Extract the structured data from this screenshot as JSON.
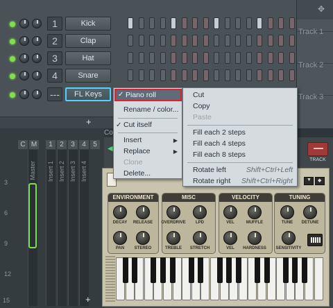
{
  "channels": [
    {
      "num": "1",
      "name": "Kick"
    },
    {
      "num": "2",
      "name": "Clap"
    },
    {
      "num": "3",
      "name": "Hat"
    },
    {
      "num": "4",
      "name": "Snare"
    },
    {
      "num": "---",
      "name": "FL Keys"
    }
  ],
  "kick_steps_on": [
    1,
    0,
    0,
    0,
    1,
    0,
    0,
    0,
    1,
    0,
    0,
    0,
    1,
    0,
    0,
    0
  ],
  "rack": {
    "add_label": "+"
  },
  "song": {
    "tracks": [
      "Track 1",
      "Track 2",
      "Track 3"
    ]
  },
  "mixer": {
    "tabs": [
      "C",
      "M",
      "1",
      "2",
      "3",
      "4",
      "5"
    ],
    "strips": [
      "Master",
      "Insert 1",
      "Insert 2",
      "Insert 3",
      "Insert 4"
    ],
    "levels": [
      "3",
      "6",
      "9",
      "12",
      "15"
    ],
    "add_label": "+"
  },
  "plugin": {
    "bar_label": "Comp",
    "track_label": "TRACK",
    "sections": [
      "ENVIRONMENT",
      "MISC",
      "VELOCITY",
      "TUNING"
    ],
    "knobs_top": [
      "DECAY",
      "RELEASE",
      "OVERDRIVE",
      "LPD",
      "VEL",
      "MUFFLE",
      "TUNE",
      "DETUNE"
    ],
    "knobs_bottom": [
      "PAN",
      "STEREO",
      "TREBLE",
      "STRETCH",
      "VEL",
      "HARDNESS",
      "SENSITIVITY"
    ]
  },
  "menu_left": {
    "items": [
      "Piano roll",
      "Rename / color...",
      "Cut itself",
      "Insert",
      "Replace",
      "Clone",
      "Delete..."
    ]
  },
  "menu_right": {
    "items": [
      "Cut",
      "Copy",
      "Paste",
      "Fill each 2 steps",
      "Fill each 4 steps",
      "Fill each 8 steps",
      "Rotate left",
      "Rotate right"
    ],
    "shortcuts": [
      "Shift+Ctrl+Left",
      "Shift+Ctrl+Right"
    ]
  },
  "colors": {
    "accent_cyan": "#4ed2ff",
    "led_green": "#7fe04a",
    "highlight_red": "#e0202f",
    "track_red": "#a23939"
  }
}
